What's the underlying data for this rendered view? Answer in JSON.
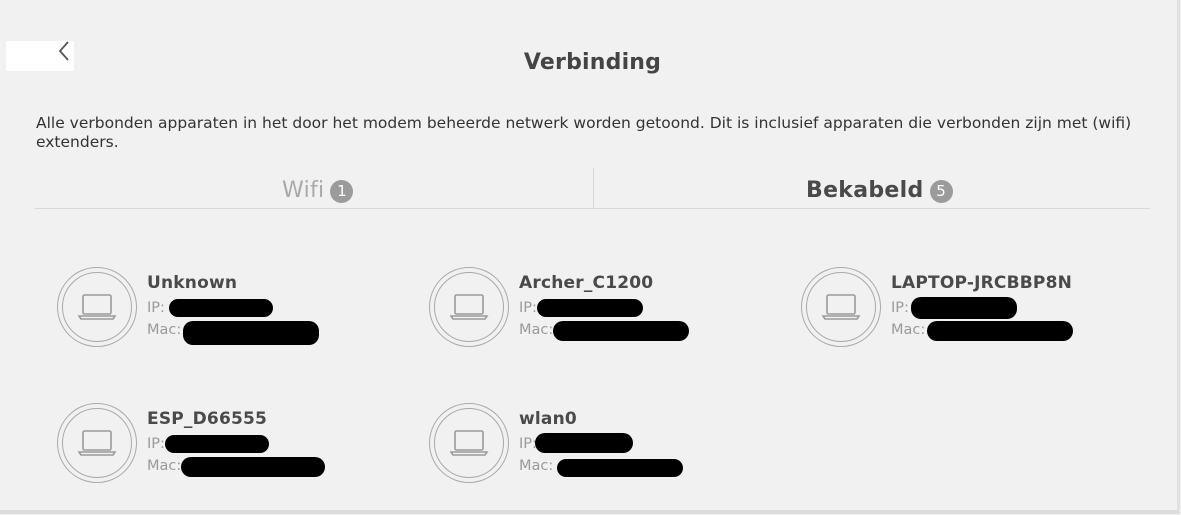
{
  "page": {
    "title": "Verbinding",
    "description": "Alle verbonden apparaten in het door het modem beheerde netwerk worden getoond. Dit is inclusief apparaten die verbonden zijn met (wifi) extenders."
  },
  "tabs": [
    {
      "label": "Wifi",
      "count": "1",
      "active": false
    },
    {
      "label": "Bekabeld",
      "count": "5",
      "active": true
    }
  ],
  "device_labels": {
    "ip": "IP:",
    "mac": "Mac:"
  },
  "devices": [
    {
      "name": "Unknown",
      "ip_label": "IP:",
      "mac_label": "Mac:"
    },
    {
      "name": "Archer_C1200",
      "ip_label": "IP:",
      "mac_label": "Mac:"
    },
    {
      "name": "LAPTOP-JRCBBP8N",
      "ip_label": "IP:",
      "mac_label": "Mac:"
    },
    {
      "name": "ESP_D66555",
      "ip_label": "IP:",
      "mac_label": "Mac:"
    },
    {
      "name": "wlan0",
      "ip_label": "IP:",
      "mac_label": "Mac:"
    }
  ],
  "icons": {
    "back": "chevron-left-icon",
    "device": "laptop-icon"
  },
  "colors": {
    "highlight": "#e6007e",
    "badge": "#9b9b9b"
  }
}
